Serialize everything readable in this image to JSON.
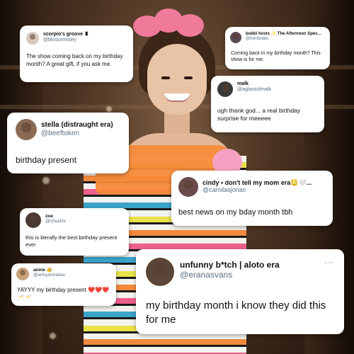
{
  "tweets": [
    {
      "name": "scorpio's groove ♜",
      "handle": "@blossomisley",
      "text": "The show coming back on my birthday month? A great gift, if you ask me.",
      "avatar_color": "#d9c8bd"
    },
    {
      "name": "bobbi hosts ✨ The Afternoon Spec...",
      "handle": "@hiimbobbi",
      "text": "Coming back in my birthday month? This show is for me.",
      "avatar_color": "#5a4a52"
    },
    {
      "name": "malk",
      "handle": "@aglassofmalk",
      "text": "ugh thank god... a real birthday surprise for meeeee",
      "avatar_color": "#3a3a3a"
    },
    {
      "name": "stella (distraught era)",
      "handle": "@beeftoken",
      "text": "birthday present",
      "avatar_color": "#8a6a55"
    },
    {
      "name": "cindy • don't tell my mom era😳🤍...",
      "handle": "@camilasjonas",
      "text": "best news on my bday month tbh",
      "avatar_color": "#6a4a4a"
    },
    {
      "name": "zoe",
      "handle": "@c0eal3x",
      "text": "this is literally the best birthday present ever",
      "avatar_color": "#4b3a33"
    },
    {
      "name": "annie 🥳",
      "handle": "@artsyannalise",
      "text": "YAYYY my birthday present ❤️❤️❤️ 🥂🥂",
      "avatar_color": "#c9a27a"
    },
    {
      "name": "unfunny b*tch | aloto era",
      "handle": "@eranasvans",
      "text": "my birthday month i know they did this for me",
      "avatar_color": "#5a4638"
    }
  ],
  "more_label": "···",
  "colors": {
    "card_bg": "#ffffff",
    "handle_gray": "#5b7083",
    "dress_stripes": [
      "#e8e24b",
      "#f38a3c",
      "#ee5f8a",
      "#3aa4c9",
      "#1a1a1a"
    ],
    "bow_pink": "#f07a9a"
  }
}
